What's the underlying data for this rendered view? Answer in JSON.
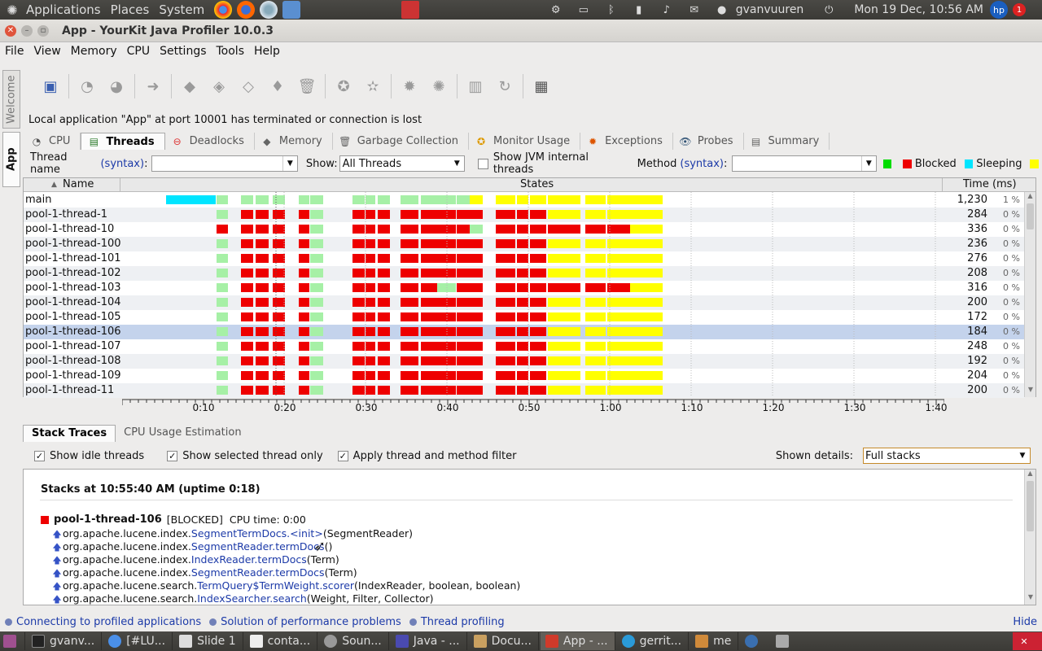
{
  "panel": {
    "menus": [
      "Applications",
      "Places",
      "System"
    ],
    "user": "gvanvuuren",
    "clock": "Mon 19 Dec, 10:56 AM",
    "notification_count": "1"
  },
  "window": {
    "title": "App - YourKit Java Profiler 10.0.3"
  },
  "menubar": [
    "File",
    "View",
    "Memory",
    "CPU",
    "Settings",
    "Tools",
    "Help"
  ],
  "sidetabs": {
    "welcome": "Welcome",
    "app": "App"
  },
  "status_message": "Local application \"App\" at port 10001 has terminated or connection is lost",
  "tabs": [
    {
      "label": "CPU"
    },
    {
      "label": "Threads"
    },
    {
      "label": "Deadlocks"
    },
    {
      "label": "Memory"
    },
    {
      "label": "Garbage Collection"
    },
    {
      "label": "Monitor Usage"
    },
    {
      "label": "Exceptions"
    },
    {
      "label": "Probes"
    },
    {
      "label": "Summary"
    }
  ],
  "filter": {
    "thread_name_label": "Thread name",
    "syntax": "(syntax)",
    "thread_name_value": "",
    "show_label": "Show:",
    "show_value": "All Threads",
    "show_jvm_label": "Show JVM internal threads",
    "method_label": "Method",
    "method_value": "",
    "legend": [
      {
        "label": "",
        "color": "#00dd00"
      },
      {
        "label": "Blocked",
        "color": "#ee0000"
      },
      {
        "label": "Sleeping",
        "color": "#00e5ff"
      },
      {
        "label": "",
        "color": "#ffff00"
      }
    ]
  },
  "grid": {
    "col_name": "Name",
    "col_states": "States",
    "col_time": "Time (ms)",
    "rows": [
      {
        "name": "main",
        "time": "1,230",
        "pct": "1 %"
      },
      {
        "name": "pool-1-thread-1",
        "time": "284",
        "pct": "0 %"
      },
      {
        "name": "pool-1-thread-10",
        "time": "336",
        "pct": "0 %"
      },
      {
        "name": "pool-1-thread-100",
        "time": "236",
        "pct": "0 %"
      },
      {
        "name": "pool-1-thread-101",
        "time": "276",
        "pct": "0 %"
      },
      {
        "name": "pool-1-thread-102",
        "time": "208",
        "pct": "0 %"
      },
      {
        "name": "pool-1-thread-103",
        "time": "316",
        "pct": "0 %"
      },
      {
        "name": "pool-1-thread-104",
        "time": "200",
        "pct": "0 %"
      },
      {
        "name": "pool-1-thread-105",
        "time": "172",
        "pct": "0 %"
      },
      {
        "name": "pool-1-thread-106",
        "time": "184",
        "pct": "0 %"
      },
      {
        "name": "pool-1-thread-107",
        "time": "248",
        "pct": "0 %"
      },
      {
        "name": "pool-1-thread-108",
        "time": "192",
        "pct": "0 %"
      },
      {
        "name": "pool-1-thread-109",
        "time": "204",
        "pct": "0 %"
      },
      {
        "name": "pool-1-thread-11",
        "time": "200",
        "pct": "0 %"
      }
    ],
    "selected_row": "pool-1-thread-106",
    "timeline_ticks": [
      "0:10",
      "0:20",
      "0:30",
      "0:40",
      "0:50",
      "1:00",
      "1:10",
      "1:20",
      "1:30",
      "1:40"
    ]
  },
  "bottom": {
    "tabs": [
      "Stack Traces",
      "CPU Usage Estimation"
    ],
    "show_idle": "Show idle threads",
    "show_selected": "Show selected thread only",
    "apply_filter": "Apply thread and method filter",
    "shown_details_label": "Shown details:",
    "shown_details_value": "Full stacks",
    "stacks_header": "Stacks at 10:55:40 AM (uptime 0:18)",
    "thread": "pool-1-thread-106",
    "thread_state": "[BLOCKED]",
    "cpu_time": "CPU time: 0:00",
    "frames": [
      {
        "pkg": "org.apache.lucene.index.",
        "method": "SegmentTermDocs.<init>",
        "args": "(SegmentReader)"
      },
      {
        "pkg": "org.apache.lucene.index.",
        "method": "SegmentReader.termDocs",
        "args": "()"
      },
      {
        "pkg": "org.apache.lucene.index.",
        "method": "IndexReader.termDocs",
        "args": "(Term)"
      },
      {
        "pkg": "org.apache.lucene.index.",
        "method": "SegmentReader.termDocs",
        "args": "(Term)"
      },
      {
        "pkg": "org.apache.lucene.search.",
        "method": "TermQuery$TermWeight.scorer",
        "args": "(IndexReader, boolean, boolean)"
      },
      {
        "pkg": "org.apache.lucene.search.",
        "method": "IndexSearcher.search",
        "args": "(Weight, Filter, Collector)"
      }
    ]
  },
  "hints": [
    "Connecting to profiled applications",
    "Solution of performance problems",
    "Thread profiling"
  ],
  "hide": "Hide",
  "taskbar": [
    "gvanv...",
    "[#LU...",
    "Slide 1",
    "conta...",
    "Soun...",
    "Java - ...",
    "Docu...",
    "App - ...",
    "gerrit...",
    "me"
  ]
}
